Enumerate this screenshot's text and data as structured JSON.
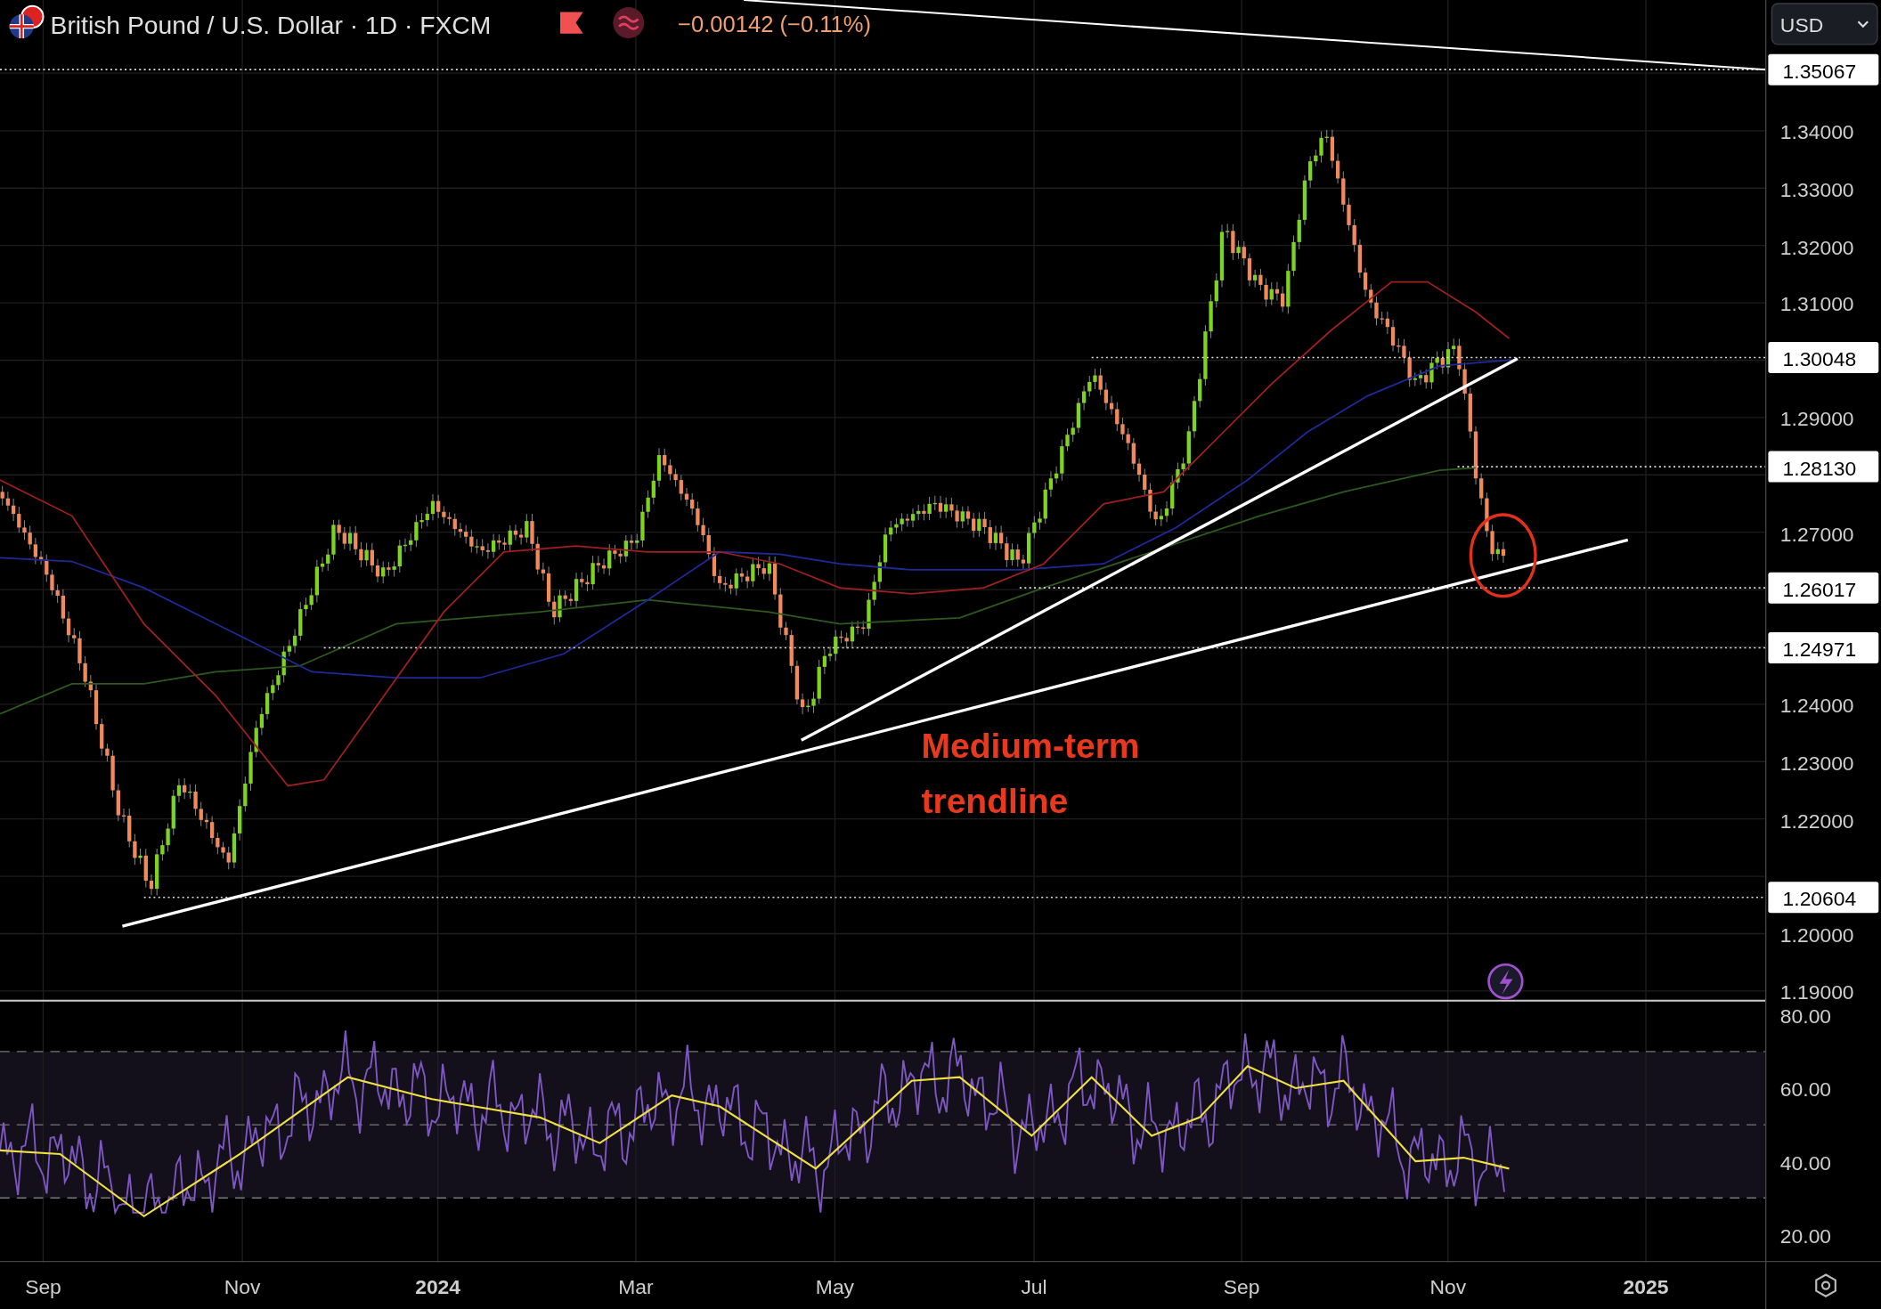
{
  "header": {
    "symbol": "British Pound / U.S. Dollar · 1D · FXCM",
    "change": "−0.00142 (−0.11%)"
  },
  "currency": "USD",
  "price_axis": {
    "ticks": [
      "1.34000",
      "1.33000",
      "1.32000",
      "1.31000",
      "1.29000",
      "1.27000",
      "1.24000",
      "1.23000",
      "1.22000",
      "1.20000",
      "1.19000"
    ],
    "markers": [
      "1.35067",
      "1.30048",
      "1.28130",
      "1.26017",
      "1.24971",
      "1.20604"
    ]
  },
  "annotation": [
    "Medium-term",
    "trendline"
  ],
  "rsi_axis": [
    "80.00",
    "60.00",
    "40.00",
    "20.00"
  ],
  "time_axis": [
    {
      "label": "Sep",
      "kind": "month"
    },
    {
      "label": "Nov",
      "kind": "month"
    },
    {
      "label": "2024",
      "kind": "year"
    },
    {
      "label": "Mar",
      "kind": "month"
    },
    {
      "label": "May",
      "kind": "month"
    },
    {
      "label": "Jul",
      "kind": "month"
    },
    {
      "label": "Sep",
      "kind": "month"
    },
    {
      "label": "Nov",
      "kind": "month"
    },
    {
      "label": "2025",
      "kind": "year"
    }
  ]
}
